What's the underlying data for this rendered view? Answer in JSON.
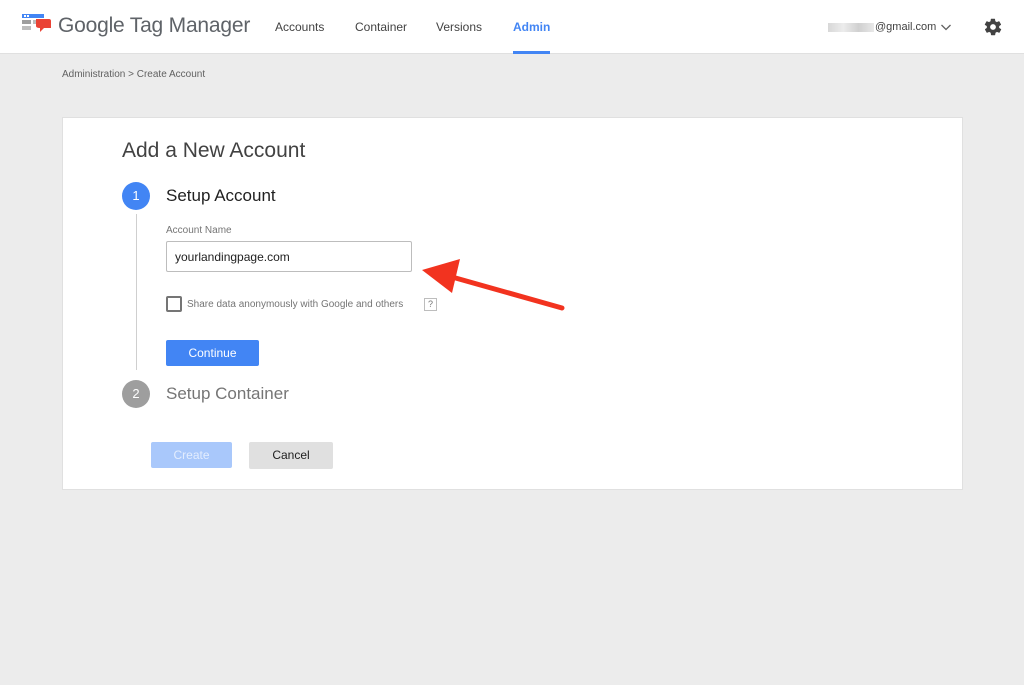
{
  "header": {
    "app_title": "Google Tag Manager",
    "nav": [
      {
        "label": "Accounts",
        "active": false
      },
      {
        "label": "Container",
        "active": false
      },
      {
        "label": "Versions",
        "active": false
      },
      {
        "label": "Admin",
        "active": true
      }
    ],
    "account_email_suffix": "@gmail.com",
    "icons": [
      "tag-manager-logo-icon",
      "chevron-down-icon",
      "gear-icon"
    ]
  },
  "breadcrumb": "Administration > Create Account",
  "card": {
    "title": "Add a New Account",
    "step1": {
      "number": "1",
      "title": "Setup Account",
      "field_label": "Account Name",
      "field_value": "yourlandingpage.com",
      "checkbox_label": "Share data anonymously with Google and others",
      "checkbox_checked": false,
      "help_label": "?",
      "continue_label": "Continue"
    },
    "step2": {
      "number": "2",
      "title": "Setup Container"
    },
    "create_label": "Create",
    "cancel_label": "Cancel"
  },
  "colors": {
    "accent": "#4285f4",
    "annotation_arrow": "#f2331f",
    "inactive_step": "#9e9e9e"
  }
}
